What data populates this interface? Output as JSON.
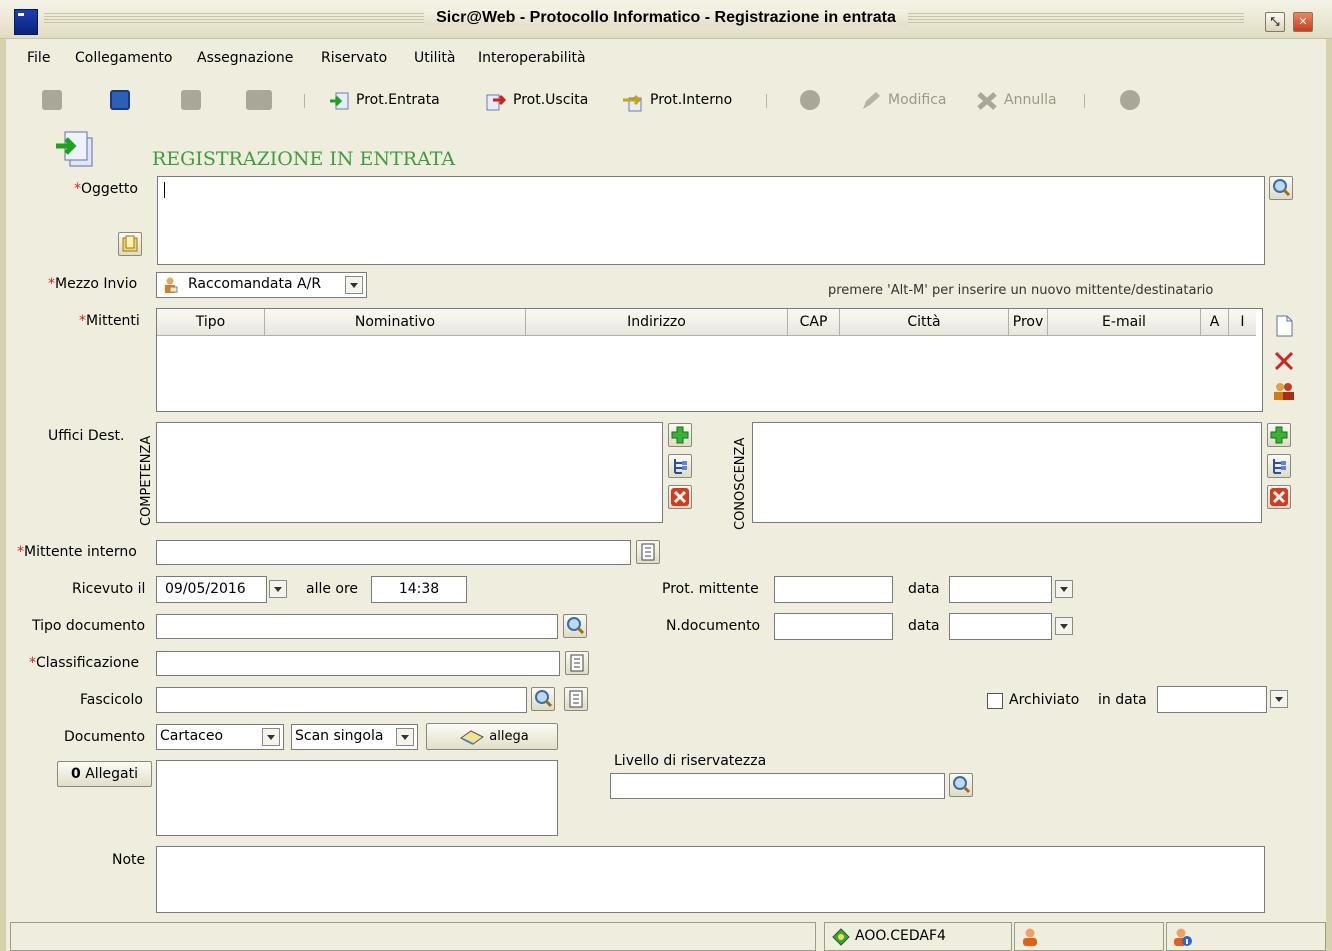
{
  "window": {
    "title": "Sicr@Web - Protocollo Informatico - Registrazione in entrata",
    "minimize_glyph": "⤡",
    "close_glyph": "✕"
  },
  "menu": [
    "File",
    "Collegamento",
    "Assegnazione",
    "Riservato",
    "Utilità",
    "Interoperabilità"
  ],
  "toolbar": {
    "prot_entrata": "Prot.Entrata",
    "prot_uscita": "Prot.Uscita",
    "prot_interno": "Prot.Interno",
    "modifica": "Modifica",
    "annulla": "Annulla"
  },
  "form": {
    "heading": "REGISTRAZIONE IN ENTRATA",
    "required_mark": "*",
    "oggetto_label": "Oggetto",
    "oggetto_value": "",
    "mezzo_invio_label": "Mezzo Invio",
    "mezzo_invio_value": "Raccomandata A/R",
    "hint": "premere 'Alt-M' per inserire un nuovo mittente/destinatario",
    "mittenti_label": "Mittenti",
    "mittenti_columns": [
      "Tipo",
      "Nominativo",
      "Indirizzo",
      "CAP",
      "Città",
      "Prov",
      "E-mail",
      "A",
      "I"
    ],
    "uffici_label": "Uffici Dest.",
    "competenza_label": "COMPETENZA",
    "conoscenza_label": "CONOSCENZA",
    "mittente_interno_label": "Mittente interno",
    "mittente_interno_value": "",
    "ricevuto_label": "Ricevuto il",
    "ricevuto_value": "09/05/2016",
    "alle_ore_label": "alle ore",
    "alle_ore_value": "14:38",
    "prot_mittente_label": "Prot. mittente",
    "data_label": "data",
    "tipo_documento_label": "Tipo documento",
    "n_documento_label": "N.documento",
    "classificazione_label": "Classificazione",
    "fascicolo_label": "Fascicolo",
    "archiviato_label": "Archiviato",
    "in_data_label": "in data",
    "documento_label": "Documento",
    "documento_value": "Cartaceo",
    "scan_value": "Scan singola",
    "allega_label": "allega",
    "allegati_label": "Allegati",
    "livello_label": "Livello di riservatezza",
    "note_label": "Note"
  },
  "status": {
    "aoo": "AOO.CEDAF4"
  }
}
